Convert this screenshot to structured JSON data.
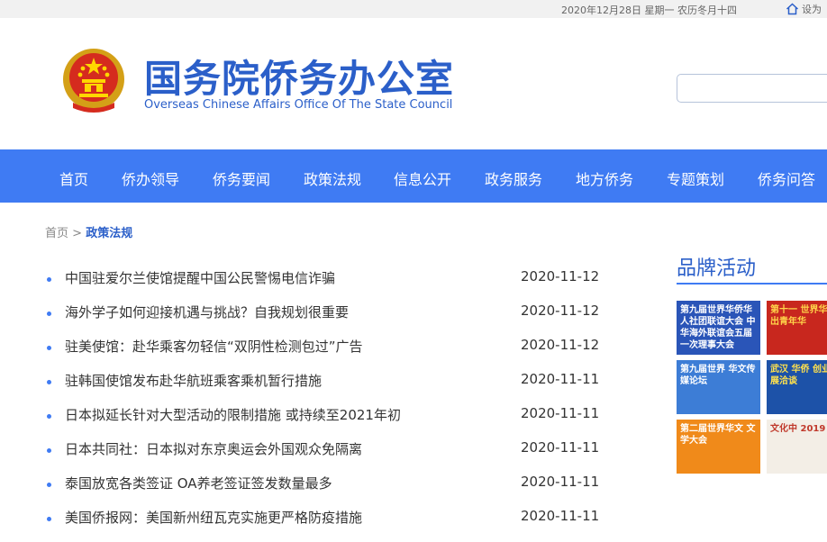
{
  "topbar": {
    "date": "2020年12月28日 星期一 农历冬月十四",
    "home_label": "设为"
  },
  "header": {
    "title_cn": "国务院侨务办公室",
    "title_en": "Overseas Chinese Affairs Office Of The State Council"
  },
  "nav": {
    "items": [
      "首页",
      "侨办领导",
      "侨务要闻",
      "政策法规",
      "信息公开",
      "政务服务",
      "地方侨务",
      "专题策划",
      "侨务问答"
    ]
  },
  "breadcrumb": {
    "home": "首页",
    "sep": ">",
    "current": "政策法规"
  },
  "articles": [
    {
      "title": "中国驻爱尔兰使馆提醒中国公民警惕电信诈骗",
      "date": "2020-11-12"
    },
    {
      "title": "海外学子如何迎接机遇与挑战？自我规划很重要",
      "date": "2020-11-12"
    },
    {
      "title": "驻美使馆：赴华乘客勿轻信“双阴性检测包过”广告",
      "date": "2020-11-12"
    },
    {
      "title": "驻韩国使馆发布赴华航班乘客乘机暂行措施",
      "date": "2020-11-11"
    },
    {
      "title": "日本拟延长针对大型活动的限制措施 或持续至2021年初",
      "date": "2020-11-11"
    },
    {
      "title": "日本共同社：日本拟对东京奥运会外国观众免隔离",
      "date": "2020-11-11"
    },
    {
      "title": "泰国放宽各类签证 OA养老签证签发数量最多",
      "date": "2020-11-11"
    },
    {
      "title": "美国侨报网：美国新州纽瓦克实施更严格防疫措施",
      "date": "2020-11-11"
    }
  ],
  "brand": {
    "title": "品牌活动",
    "tiles": [
      {
        "text": "第九届世界华侨华人社团联谊大会 中华海外联谊会五届一次理事大会",
        "bg": "#2a55b8",
        "fg": "#ffffff"
      },
      {
        "text": "第十一 世界华 杰出青年华",
        "bg": "#c8271e",
        "fg": "#ffd54a"
      },
      {
        "text": "第九届世界 华文传媒论坛",
        "bg": "#3d7dd6",
        "fg": "#ffffff"
      },
      {
        "text": "武汉 华侨 创业发展洽谈",
        "bg": "#1d52a8",
        "fg": "#ffe14d"
      },
      {
        "text": "第二届世界华文 文学大会",
        "bg": "#f08a1a",
        "fg": "#ffffff"
      },
      {
        "text": "文化中 2019",
        "bg": "#f3eee6",
        "fg": "#c0392b"
      }
    ]
  },
  "colors": {
    "nav_bg": "#3f7bf3",
    "title": "#2b5fc9",
    "bullet": "#3f7bf3"
  }
}
